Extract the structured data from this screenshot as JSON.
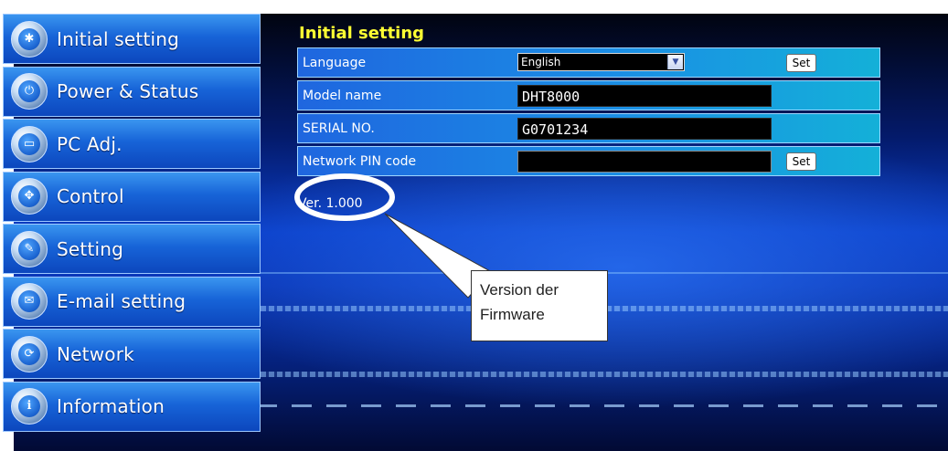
{
  "sidebar": {
    "items": [
      {
        "label": "Initial setting",
        "icon": "gear-icon",
        "glyph": "✱"
      },
      {
        "label": "Power & Status",
        "icon": "power-icon",
        "glyph": "⏻"
      },
      {
        "label": "PC Adj.",
        "icon": "monitor-icon",
        "glyph": "▭"
      },
      {
        "label": "Control",
        "icon": "arrows-icon",
        "glyph": "✥"
      },
      {
        "label": "Setting",
        "icon": "tools-icon",
        "glyph": "✎"
      },
      {
        "label": "E-mail setting",
        "icon": "envelope-icon",
        "glyph": "✉"
      },
      {
        "label": "Network",
        "icon": "network-icon",
        "glyph": "⟳"
      },
      {
        "label": "Information",
        "icon": "info-icon",
        "glyph": "ℹ"
      }
    ]
  },
  "main": {
    "title": "Initial setting",
    "rows": {
      "language": {
        "label": "Language",
        "value": "English",
        "button": "Set"
      },
      "model": {
        "label": "Model name",
        "value": "DHT8000"
      },
      "serial": {
        "label": "SERIAL NO.",
        "value": "G0701234"
      },
      "pin": {
        "label": "Network PIN code",
        "value": "",
        "button": "Set"
      }
    },
    "version": "Ver. 1.000"
  },
  "callout": {
    "line1": "Version der",
    "line2": "Firmware"
  },
  "colors": {
    "title": "#ffff33",
    "highlight_ring": "#ffffff"
  }
}
